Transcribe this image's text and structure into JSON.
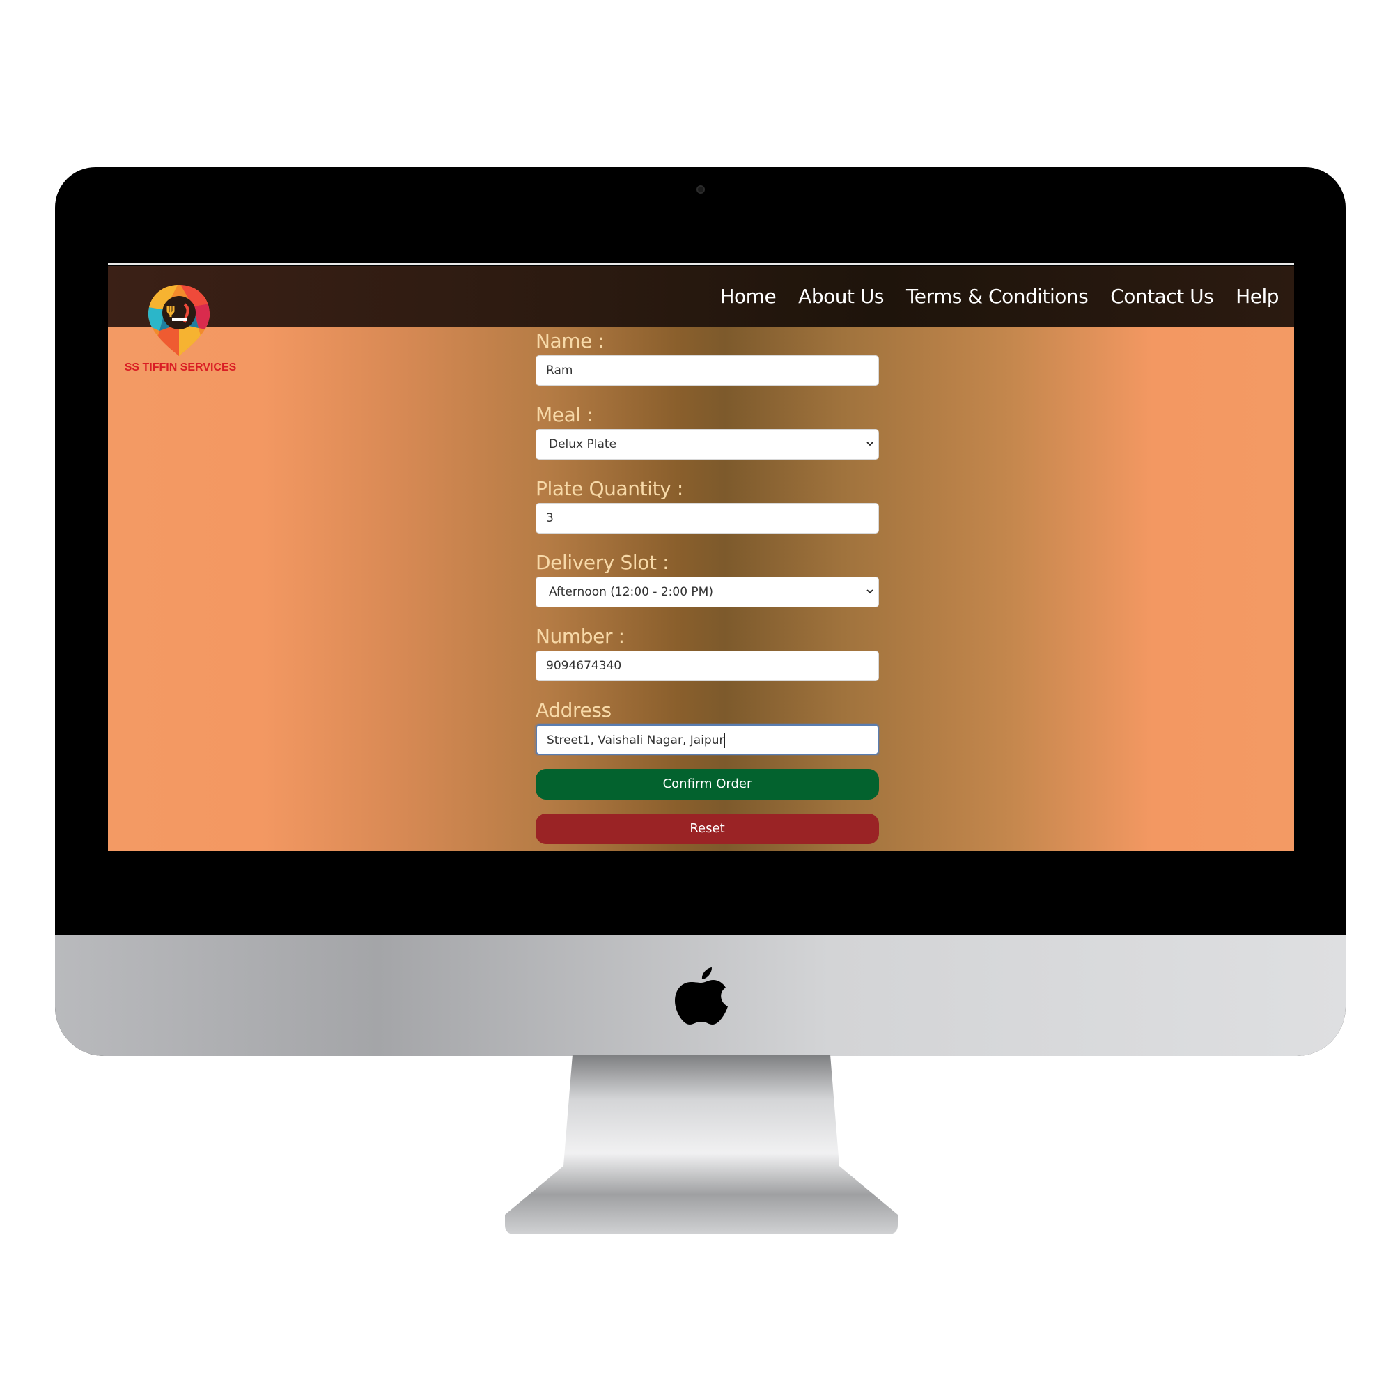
{
  "brand": {
    "name": "SS TIFFIN SERVICES",
    "text_color": "#d91d24"
  },
  "nav": {
    "items": [
      "Home",
      "About Us",
      "Terms & Conditions",
      "Contact Us",
      "Help"
    ]
  },
  "form": {
    "name": {
      "label": "Name :",
      "value": "Ram"
    },
    "meal": {
      "label": "Meal :",
      "value": "Delux Plate"
    },
    "quantity": {
      "label": "Plate Quantity :",
      "value": "3"
    },
    "slot": {
      "label": "Delivery Slot :",
      "value": "Afternoon (12:00 - 2:00 PM)"
    },
    "number": {
      "label": "Number :",
      "value": "9094674340"
    },
    "address": {
      "label": "Address",
      "value": "Street1, Vaishali Nagar, Jaipur"
    },
    "confirm_label": "Confirm Order",
    "reset_label": "Reset"
  },
  "colors": {
    "confirm_button": "#03622e",
    "reset_button": "#9a2325",
    "label_text": "#f7d9a8"
  },
  "icons": {
    "logo": "map-pin-food-icon",
    "select_arrow": "chevron-down-icon",
    "device": "apple-logo-icon"
  }
}
